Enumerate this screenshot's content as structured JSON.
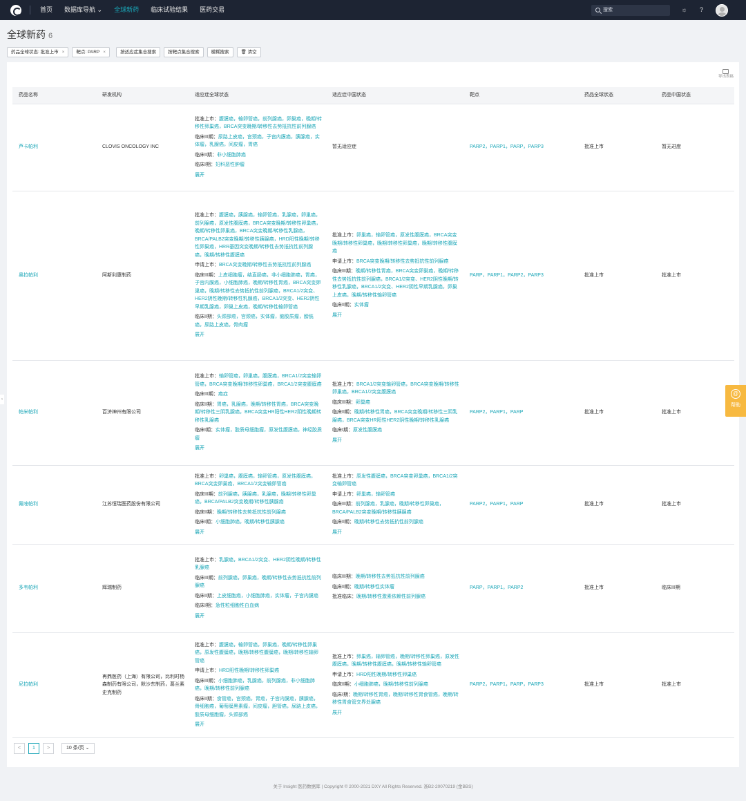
{
  "topbar": {
    "nav": [
      "首页",
      "数据库导航",
      "全球新药",
      "临床试验结果",
      "医药交易"
    ],
    "nav_dropdown_caret": "⌄",
    "active_index": 2,
    "search_label": "搜索"
  },
  "page": {
    "title": "全球新药",
    "count": "6",
    "filters": [
      {
        "label": "药品全球状态: 批准上市"
      },
      {
        "label": "靶点: PARP"
      }
    ],
    "buttons": [
      "按适应症集合搜索",
      "按靶点集合搜索",
      "模糊搜索",
      "清空"
    ]
  },
  "table": {
    "export_label": "导出表格",
    "headers": [
      "药品名称",
      "研发机构",
      "适应症全球状态",
      "适应症中国状态",
      "靶点",
      "药品全球状态",
      "药品中国状态"
    ],
    "expand_label": "展开",
    "rows": [
      {
        "name": "芦卡帕利",
        "org": "CLOVIS ONCOLOGY INC",
        "global": [
          {
            "label": "批准上市：",
            "text": "腹膜癌，输卵管癌，前列腺癌，卵巢癌，晚期/转移性卵巢癌，BRCA突变晚期/转移性去势抵抗性前列腺癌"
          },
          {
            "label": "临床III期：",
            "text": "尿路上皮癌，宫颈癌，子宫内膜癌，胰腺癌，实体瘤，乳腺癌，间皮瘤，胃癌"
          },
          {
            "label": "临床II期：",
            "text": "非小细胞肺癌"
          },
          {
            "label": "临床I期：",
            "text": "妇科恶性肿瘤"
          }
        ],
        "china_plain": "暂无适应症",
        "china": [],
        "china_expand": false,
        "targets": "PARP2，PARP1，PARP，PARP3",
        "global_status": "批准上市",
        "china_status": "暂无进度"
      },
      {
        "name": "奥拉帕利",
        "org": "阿斯利康制药",
        "global": [
          {
            "label": "批准上市：",
            "text": "腹膜癌，胰腺癌，输卵管癌，乳腺癌，卵巢癌，前列腺癌，原发性腹膜癌，BRCA突变晚期/转移性卵巢癌，晚期/转移性卵巢癌，BRCA突变晚期/转移性乳腺癌，BRCA/PALB2突变晚期/转移性胰腺癌，HRD阳性晚期/转移性卵巢癌，HRR基因突变晚期/转移性去势抵抗性前列腺癌，晚期/转移性腹膜癌"
          },
          {
            "label": "申请上市：",
            "text": "BRCA突变晚期/转移性去势抵抗性前列腺癌"
          },
          {
            "label": "临床III期：",
            "text": "上皮细胞瘤，结直肠癌，非小细胞肺癌，胃癌，子宫内膜癌，小细胞肺癌，晚期/转移性胃癌，BRCA突变卵巢癌，晚期/转移性去势抵抗性前列腺癌，BRCA1/2突变、HER2阴性晚期/转移性乳腺癌，BRCA1/2突变、HER2阴性早期乳腺癌，卵巢上皮癌，晚期/转移性输卵管癌"
          },
          {
            "label": "临床II期：",
            "text": "头颈部癌，宫颈癌，实体瘤，脑胶质瘤，膀胱癌，尿路上皮癌，骨肉瘤"
          }
        ],
        "china_plain": "",
        "china": [
          {
            "label": "批准上市：",
            "text": "卵巢癌，输卵管癌，原发性腹膜癌，BRCA突变晚期/转移性卵巢癌，晚期/转移性卵巢癌，晚期/转移性腹膜癌"
          },
          {
            "label": "申请上市：",
            "text": "BRCA突变晚期/转移性去势抵抗性前列腺癌"
          },
          {
            "label": "临床III期：",
            "text": "晚期/转移性胃癌，BRCA突变卵巢癌，晚期/转移性去势抵抗性前列腺癌，BRCA1/2突变、HER2阴性晚期/转移性乳腺癌，BRCA1/2突变、HER2阴性早期乳腺癌，卵巢上皮癌，晚期/转移性输卵管癌"
          },
          {
            "label": "临床II期：",
            "text": "实体瘤"
          }
        ],
        "china_expand": true,
        "targets": "PARP，PARP1，PARP2，PARP3",
        "global_status": "批准上市",
        "china_status": "批准上市"
      },
      {
        "name": "帕米帕利",
        "org": "百济神州有限公司",
        "global": [
          {
            "label": "批准上市：",
            "text": "输卵管癌，卵巢癌，腹膜癌，BRCA1/2突变输卵管癌，BRCA突变晚期/转移性卵巢癌，BRCA1/2突变腹膜癌"
          },
          {
            "label": "临床III期：",
            "text": "癌症"
          },
          {
            "label": "临床II期：",
            "text": "胃癌，乳腺癌，晚期/转移性胃癌，BRCA突变晚期/转移性三阴乳腺癌，BRCA突变HR阳性HER2阴性晚期转移性乳腺癌"
          },
          {
            "label": "临床I期：",
            "text": "实体瘤，胶质母细胞瘤，原发性腹膜癌，神经胶质瘤"
          }
        ],
        "china_plain": "",
        "china": [
          {
            "label": "批准上市：",
            "text": "BRCA1/2突变输卵管癌，BRCA突变晚期/转移性卵巢癌，BRCA1/2突变腹膜癌"
          },
          {
            "label": "临床III期：",
            "text": "卵巢癌"
          },
          {
            "label": "临床II期：",
            "text": "晚期/转移性胃癌，BRCA突变晚期/转移性三阴乳腺癌，BRCA突变HR阳性HER2阴性晚期/转移性乳腺癌"
          },
          {
            "label": "临床I期：",
            "text": "原发性腹膜癌"
          }
        ],
        "china_expand": true,
        "targets": "PARP2，PARP1，PARP",
        "global_status": "批准上市",
        "china_status": "批准上市"
      },
      {
        "name": "氟唑帕利",
        "org": "江苏恒瑞医药股份有限公司",
        "global": [
          {
            "label": "批准上市：",
            "text": "卵巢癌，腹膜癌，输卵管癌，原发性腹膜癌，BRCA突变卵巢癌，BRCA1/2突变输卵管癌"
          },
          {
            "label": "临床III期：",
            "text": "前列腺癌，胰腺癌，乳腺癌，晚期/转移性卵巢癌，BRCA/PALB2突变晚期/转移性胰腺癌"
          },
          {
            "label": "临床II期：",
            "text": "晚期/转移性去势抵抗性前列腺癌"
          },
          {
            "label": "临床I期：",
            "text": "小细胞肺癌，晚期/转移性胰腺癌"
          }
        ],
        "china_plain": "",
        "china": [
          {
            "label": "批准上市：",
            "text": "原发性腹膜癌，BRCA突变卵巢癌，BRCA1/2突变输卵管癌"
          },
          {
            "label": "申请上市：",
            "text": "卵巢癌，输卵管癌"
          },
          {
            "label": "临床III期：",
            "text": "前列腺癌，乳腺癌，晚期/转移性卵巢癌，BRCA/PALB2突变晚期/转移性胰腺癌"
          },
          {
            "label": "临床II期：",
            "text": "晚期/转移性去势抵抗性前列腺癌"
          }
        ],
        "china_expand": true,
        "targets": "PARP2，PARP1，PARP",
        "global_status": "批准上市",
        "china_status": "批准上市"
      },
      {
        "name": "多韦帕利",
        "org": "辉瑞制药",
        "global": [
          {
            "label": "批准上市：",
            "text": "乳腺癌，BRCA1/2突变、HER2阴性晚期/转移性乳腺癌"
          },
          {
            "label": "临床III期：",
            "text": "前列腺癌，卵巢癌，晚期/转移性去势抵抗性前列腺癌"
          },
          {
            "label": "临床II期：",
            "text": "上皮细胞癌，小细胞肺癌，实体瘤，子宫内膜癌"
          },
          {
            "label": "临床I期：",
            "text": "急性粒细胞性白血病"
          }
        ],
        "china_plain": "",
        "china": [
          {
            "label": "临床III期：",
            "text": "晚期/转移性去势抵抗性前列腺癌"
          },
          {
            "label": "临床II期：",
            "text": "晚期/转移性实体瘤"
          },
          {
            "label": "批准临床：",
            "text": "晚期/转移性激素依赖性前列腺癌"
          }
        ],
        "china_expand": false,
        "targets": "PARP，PARP1，PARP2",
        "global_status": "批准上市",
        "china_status": "临床III期"
      },
      {
        "name": "尼拉帕利",
        "org": "再鼎医药（上海）有限公司，比利时杨森制药有限公司，默沙东制药，葛兰素史克制药",
        "global": [
          {
            "label": "批准上市：",
            "text": "腹膜癌，输卵管癌，卵巢癌，晚期/转移性卵巢癌，原发性腹膜癌，晚期/转移性腹膜癌，晚期/转移性输卵管癌"
          },
          {
            "label": "申请上市：",
            "text": "HRD阳性晚期/转移性卵巢癌"
          },
          {
            "label": "临床III期：",
            "text": "小细胞肺癌，乳腺癌，前列腺癌，非小细胞肺癌，晚期/转移性前列腺癌"
          },
          {
            "label": "临床II期：",
            "text": "食管癌，宫颈癌，胃癌，子宫内膜癌，胰腺癌，骨细胞癌，葡萄膜黑素瘤，间皮瘤，胆管癌，尿路上皮癌，胶质母细胞瘤，头颈部癌"
          }
        ],
        "china_plain": "",
        "china": [
          {
            "label": "批准上市：",
            "text": "卵巢癌，输卵管癌，晚期/转移性卵巢癌，原发性腹膜癌，晚期/转移性腹膜癌，晚期/转移性输卵管癌"
          },
          {
            "label": "申请上市：",
            "text": "HRD阳性晚期/转移性卵巢癌"
          },
          {
            "label": "临床II期：",
            "text": "小细胞肺癌，晚期/转移性前列腺癌"
          },
          {
            "label": "临床I期：",
            "text": "晚期/转移性胃癌，晚期/转移性胃食管癌，晚期/转移性胃食管交界处腺癌"
          }
        ],
        "china_expand": true,
        "targets": "PARP2，PARP1，PARP，PARP3",
        "global_status": "批准上市",
        "china_status": "批准上市"
      }
    ]
  },
  "pager": {
    "prev": "<",
    "current": "1",
    "next": ">",
    "size": "10 条/页"
  },
  "footer": "关于 Insight 医药数据库 | Copyright © 2000-2021 DXY All Rights Reserved. 浙B2-20070219 (金BBS)",
  "help_label": "帮助",
  "colors": {
    "accent": "#1aa6b7",
    "topbar": "#1d2433",
    "help": "#f7b940"
  }
}
